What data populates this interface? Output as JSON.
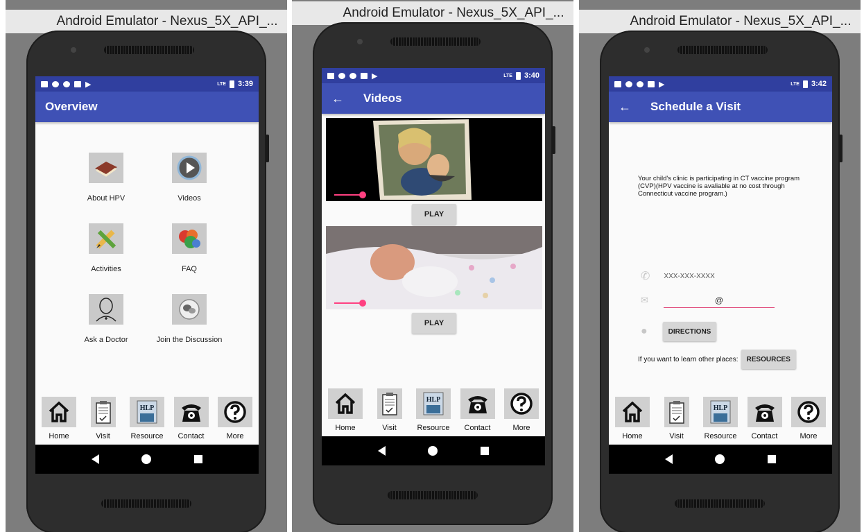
{
  "window_title": "Android Emulator - Nexus_5X_API_...",
  "screens": [
    {
      "status_time": "3:39",
      "status_lte": "LTE",
      "appbar_title": "Overview",
      "grid": [
        {
          "label": "About HPV",
          "icon": "book-icon"
        },
        {
          "label": "Videos",
          "icon": "play-icon"
        },
        {
          "label": "Activities",
          "icon": "pencil-icon"
        },
        {
          "label": "FAQ",
          "icon": "faq-icon"
        },
        {
          "label": "Ask a Doctor",
          "icon": "doctor-icon"
        },
        {
          "label": "Join the Discussion",
          "icon": "discussion-icon"
        }
      ]
    },
    {
      "status_time": "3:40",
      "status_lte": "LTE",
      "appbar_title": "Videos",
      "play_label": "PLAY"
    },
    {
      "status_time": "3:42",
      "status_lte": "LTE",
      "appbar_title": "Schedule a Visit",
      "info": "Your child's clinic is participating in CT vaccine program (CVP)(HPV vaccine is avaliable at no cost through Connecticut vaccine program.)",
      "phone_placeholder": "XXX-XXX-XXXX",
      "email_value": "@",
      "directions_label": "DIRECTIONS",
      "resources_prompt": "If you want to learn other places:",
      "resources_label": "RESOURCES"
    }
  ],
  "bottom_menu": [
    {
      "label": "Home",
      "icon": "home-icon"
    },
    {
      "label": "Visit",
      "icon": "clipboard-icon"
    },
    {
      "label": "Resource",
      "icon": "help-book-icon",
      "icon_text": "HLP"
    },
    {
      "label": "Contact",
      "icon": "telephone-icon"
    },
    {
      "label": "More",
      "icon": "question-icon"
    }
  ],
  "colors": {
    "status_bar": "#303f9f",
    "app_bar": "#3f51b5",
    "accent": "#ff4081"
  }
}
